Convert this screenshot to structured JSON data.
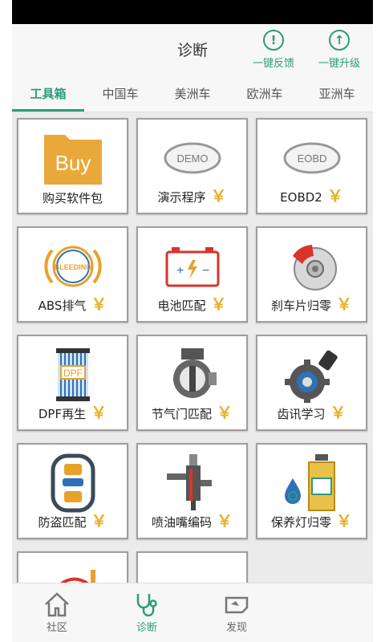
{
  "header": {
    "title": "诊断",
    "feedback_label": "一键反馈",
    "upgrade_label": "一键升级"
  },
  "tabs": [
    {
      "label": "工具箱",
      "active": true
    },
    {
      "label": "中国车"
    },
    {
      "label": "美洲车"
    },
    {
      "label": "欧洲车"
    },
    {
      "label": "亚洲车"
    }
  ],
  "tools": [
    {
      "label": "购买软件包",
      "icon": "buy-folder-icon",
      "badge_text": "Buy",
      "paid": false
    },
    {
      "label": "演示程序",
      "icon": "demo-badge-icon",
      "badge_text": "DEMO",
      "paid": true
    },
    {
      "label": "EOBD2",
      "icon": "eobd-badge-icon",
      "badge_text": "EOBD",
      "paid": true
    },
    {
      "label": "ABS排气",
      "icon": "abs-bleeding-icon",
      "badge_text": "BLEEDING",
      "paid": true
    },
    {
      "label": "电池匹配",
      "icon": "battery-icon",
      "paid": true
    },
    {
      "label": "刹车片归零",
      "icon": "brake-disc-icon",
      "paid": true
    },
    {
      "label": "DPF再生",
      "icon": "dpf-filter-icon",
      "badge_text": "DPF",
      "paid": true
    },
    {
      "label": "节气门匹配",
      "icon": "throttle-body-icon",
      "paid": true
    },
    {
      "label": "齿讯学习",
      "icon": "gear-sensor-icon",
      "paid": true
    },
    {
      "label": "防盗匹配",
      "icon": "car-key-icon",
      "paid": true
    },
    {
      "label": "喷油嘴编码",
      "icon": "injector-icon",
      "paid": true
    },
    {
      "label": "保养灯归零",
      "icon": "oil-reset-icon",
      "paid": true
    }
  ],
  "yen_symbol": "￥",
  "bottom_nav": [
    {
      "label": "社区",
      "icon": "home-icon"
    },
    {
      "label": "诊断",
      "icon": "stethoscope-icon",
      "active": true
    },
    {
      "label": "发现",
      "icon": "discover-icon"
    }
  ],
  "colors": {
    "accent": "#2a9c7a",
    "yen": "#e8b028"
  }
}
